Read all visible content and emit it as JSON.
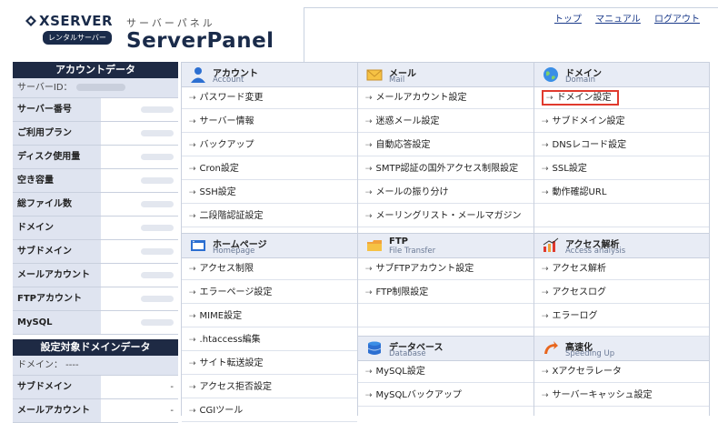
{
  "header": {
    "logo_text": "XSERVER",
    "logo_badge": "レンタルサーバー",
    "sub_title": "サーバーパネル",
    "title": "ServerPanel",
    "nav": [
      "トップ",
      "マニュアル",
      "ログアウト"
    ]
  },
  "account_panel": {
    "title": "アカウントデータ",
    "server_id_label": "サーバーID：",
    "rows": [
      {
        "label": "サーバー番号",
        "value": ""
      },
      {
        "label": "ご利用プラン",
        "value": ""
      },
      {
        "label": "ディスク使用量",
        "value": ""
      },
      {
        "label": "空き容量",
        "value": ""
      },
      {
        "label": "総ファイル数",
        "value": ""
      },
      {
        "label": "ドメイン",
        "value": ""
      },
      {
        "label": "サブドメイン",
        "value": ""
      },
      {
        "label": "メールアカウント",
        "value": ""
      },
      {
        "label": "FTPアカウント",
        "value": ""
      },
      {
        "label": "MySQL",
        "value": ""
      }
    ]
  },
  "domain_panel": {
    "title": "設定対象ドメインデータ",
    "domain_label": "ドメイン： ----",
    "rows": [
      {
        "label": "サブドメイン",
        "value": "-"
      },
      {
        "label": "メールアカウント",
        "value": "-"
      }
    ]
  },
  "sections": {
    "account": {
      "title": "アカウント",
      "sub": "Account",
      "icon": "user-icon",
      "items": [
        "パスワード変更",
        "サーバー情報",
        "バックアップ",
        "Cron設定",
        "SSH設定",
        "二段階認証設定"
      ]
    },
    "mail": {
      "title": "メール",
      "sub": "Mail",
      "icon": "mail-icon",
      "items": [
        "メールアカウント設定",
        "迷惑メール設定",
        "自動応答設定",
        "SMTP認証の国外アクセス制限設定",
        "メールの振り分け",
        "メーリングリスト・メールマガジン"
      ]
    },
    "domain": {
      "title": "ドメイン",
      "sub": "Domain",
      "icon": "globe-icon",
      "items": [
        "ドメイン設定",
        "サブドメイン設定",
        "DNSレコード設定",
        "SSL設定",
        "動作確認URL"
      ]
    },
    "homepage": {
      "title": "ホームページ",
      "sub": "Homepage",
      "icon": "homepage-icon",
      "items": [
        "アクセス制限",
        "エラーページ設定",
        "MIME設定",
        ".htaccess編集",
        "サイト転送設定",
        "アクセス拒否設定",
        "CGIツール"
      ]
    },
    "ftp": {
      "title": "FTP",
      "sub": "File Transfer",
      "icon": "folder-icon",
      "items": [
        "サブFTPアカウント設定",
        "FTP制限設定"
      ]
    },
    "analytics": {
      "title": "アクセス解析",
      "sub": "Access analysis",
      "icon": "analytics-icon",
      "items": [
        "アクセス解析",
        "アクセスログ",
        "エラーログ"
      ]
    },
    "database": {
      "title": "データベース",
      "sub": "Database",
      "icon": "database-icon",
      "items": [
        "MySQL設定",
        "MySQLバックアップ"
      ]
    },
    "speedup": {
      "title": "高速化",
      "sub": "Speeding Up",
      "icon": "speedup-icon",
      "items": [
        "Xアクセラレータ",
        "サーバーキャッシュ設定"
      ]
    }
  },
  "colors": {
    "header_dark": "#1e2a44",
    "label_bg": "#dfe4f0",
    "highlight": "#e03a2e",
    "link": "#1a3a8a"
  }
}
